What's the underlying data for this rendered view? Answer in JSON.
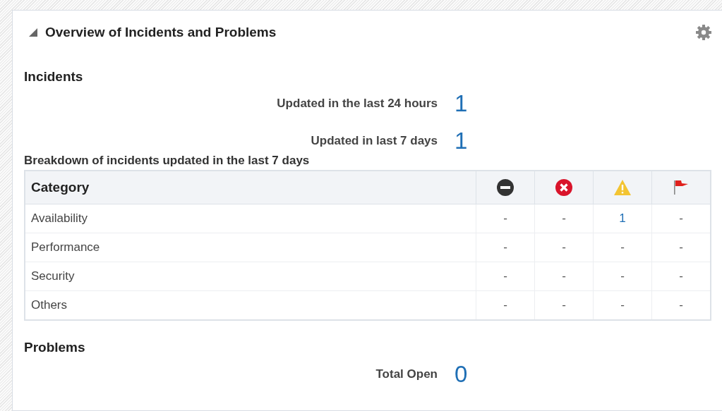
{
  "panel": {
    "title": "Overview of Incidents and Problems",
    "expanded": true
  },
  "incidents": {
    "heading": "Incidents",
    "stats": [
      {
        "label": "Updated in the last 24 hours",
        "value": "1"
      },
      {
        "label": "Updated in last 7 days",
        "value": "1"
      }
    ],
    "breakdown_title": "Breakdown of incidents updated in the last 7 days",
    "table": {
      "columns": [
        {
          "kind": "text",
          "label": "Category"
        },
        {
          "kind": "minus-circle"
        },
        {
          "kind": "x-circle"
        },
        {
          "kind": "warning"
        },
        {
          "kind": "flag"
        }
      ],
      "rows": [
        {
          "category": "Availability",
          "cells": [
            {
              "value": "-",
              "link": false
            },
            {
              "value": "-",
              "link": false
            },
            {
              "value": "1",
              "link": true
            },
            {
              "value": "-",
              "link": false
            }
          ]
        },
        {
          "category": "Performance",
          "cells": [
            {
              "value": "-",
              "link": false
            },
            {
              "value": "-",
              "link": false
            },
            {
              "value": "-",
              "link": false
            },
            {
              "value": "-",
              "link": false
            }
          ]
        },
        {
          "category": "Security",
          "cells": [
            {
              "value": "-",
              "link": false
            },
            {
              "value": "-",
              "link": false
            },
            {
              "value": "-",
              "link": false
            },
            {
              "value": "-",
              "link": false
            }
          ]
        },
        {
          "category": "Others",
          "cells": [
            {
              "value": "-",
              "link": false
            },
            {
              "value": "-",
              "link": false
            },
            {
              "value": "-",
              "link": false
            },
            {
              "value": "-",
              "link": false
            }
          ]
        }
      ]
    }
  },
  "problems": {
    "heading": "Problems",
    "stats": [
      {
        "label": "Total Open",
        "value": "0"
      }
    ]
  }
}
